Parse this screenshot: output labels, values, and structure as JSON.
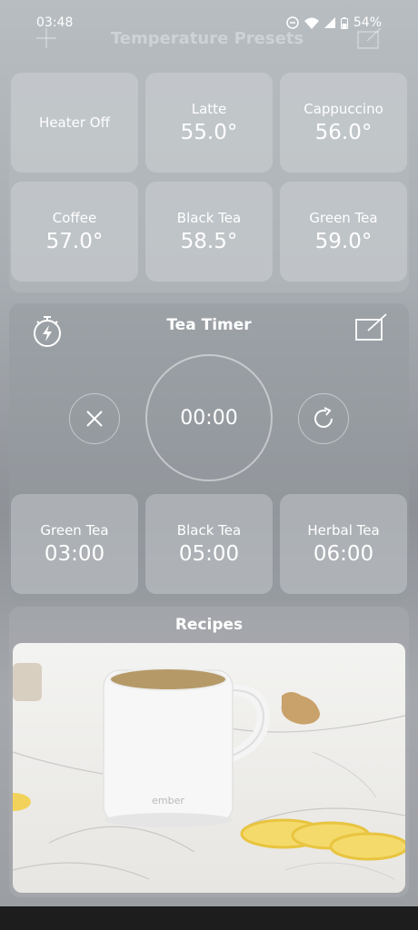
{
  "status": {
    "time": "03:48",
    "battery": "54%"
  },
  "header": {
    "title": "Temperature Presets"
  },
  "presets": [
    {
      "label": "Heater Off",
      "value": ""
    },
    {
      "label": "Latte",
      "value": "55.0°"
    },
    {
      "label": "Cappuccino",
      "value": "56.0°"
    },
    {
      "label": "Coffee",
      "value": "57.0°"
    },
    {
      "label": "Black Tea",
      "value": "58.5°"
    },
    {
      "label": "Green Tea",
      "value": "59.0°"
    }
  ],
  "timer": {
    "title": "Tea Timer",
    "display": "00:00",
    "presets": [
      {
        "label": "Green Tea",
        "value": "03:00"
      },
      {
        "label": "Black Tea",
        "value": "05:00"
      },
      {
        "label": "Herbal Tea",
        "value": "06:00"
      }
    ]
  },
  "recipes": {
    "title": "Recipes",
    "mug_brand": "ember"
  },
  "icons": {
    "add": "plus-icon",
    "edit": "edit-icon",
    "timer": "stopwatch-icon",
    "cancel": "close-icon",
    "reset": "refresh-icon"
  }
}
